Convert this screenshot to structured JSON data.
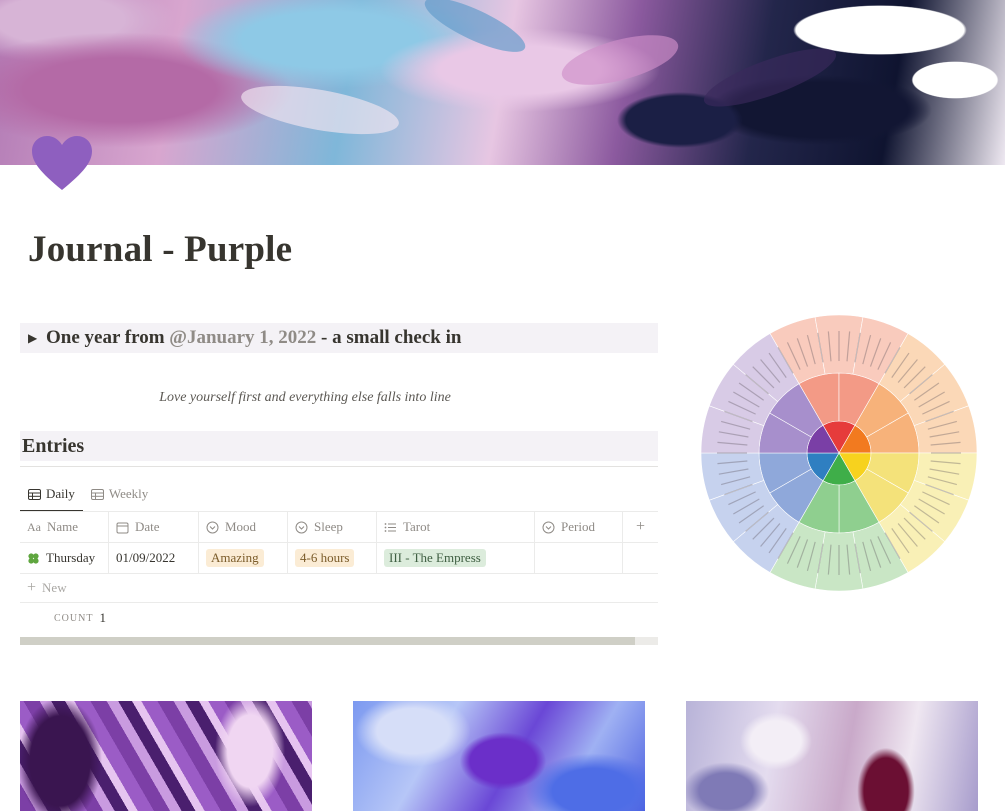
{
  "page": {
    "title": "Journal - Purple",
    "icon": "purple-heart-icon"
  },
  "toggle": {
    "prefix": "One year from ",
    "mention": "@January 1, 2022",
    "suffix": " - a small check in"
  },
  "quote": "Love yourself first and everything else falls into line",
  "entries": {
    "heading": "Entries",
    "views": [
      {
        "label": "Daily",
        "icon": "table-icon",
        "active": true
      },
      {
        "label": "Weekly",
        "icon": "table-icon",
        "active": false
      }
    ],
    "columns": [
      {
        "label": "Name",
        "icon": "text-icon"
      },
      {
        "label": "Date",
        "icon": "calendar-icon"
      },
      {
        "label": "Mood",
        "icon": "select-icon"
      },
      {
        "label": "Sleep",
        "icon": "select-icon"
      },
      {
        "label": "Tarot",
        "icon": "list-icon"
      },
      {
        "label": "Period",
        "icon": "select-icon"
      }
    ],
    "rows": [
      {
        "icon": "four-leaf-clover-icon",
        "name": "Thursday",
        "date": "01/09/2022",
        "mood": "Amazing",
        "sleep": "4-6 hours",
        "tarot": "III - The Empress",
        "period": ""
      }
    ],
    "new_label": "New",
    "add_column_label": "+",
    "count_label": "COUNT",
    "count_value": "1"
  },
  "colors": {
    "accent_purple": "#8e5fbf",
    "heading_bg": "#f4f2f6",
    "tag_orange": "#fbecd5",
    "tag_green": "#dcecdc"
  },
  "images": [
    "emotion-wheel-image",
    "purple-marble-image",
    "blue-marble-image",
    "lilac-marble-image"
  ]
}
